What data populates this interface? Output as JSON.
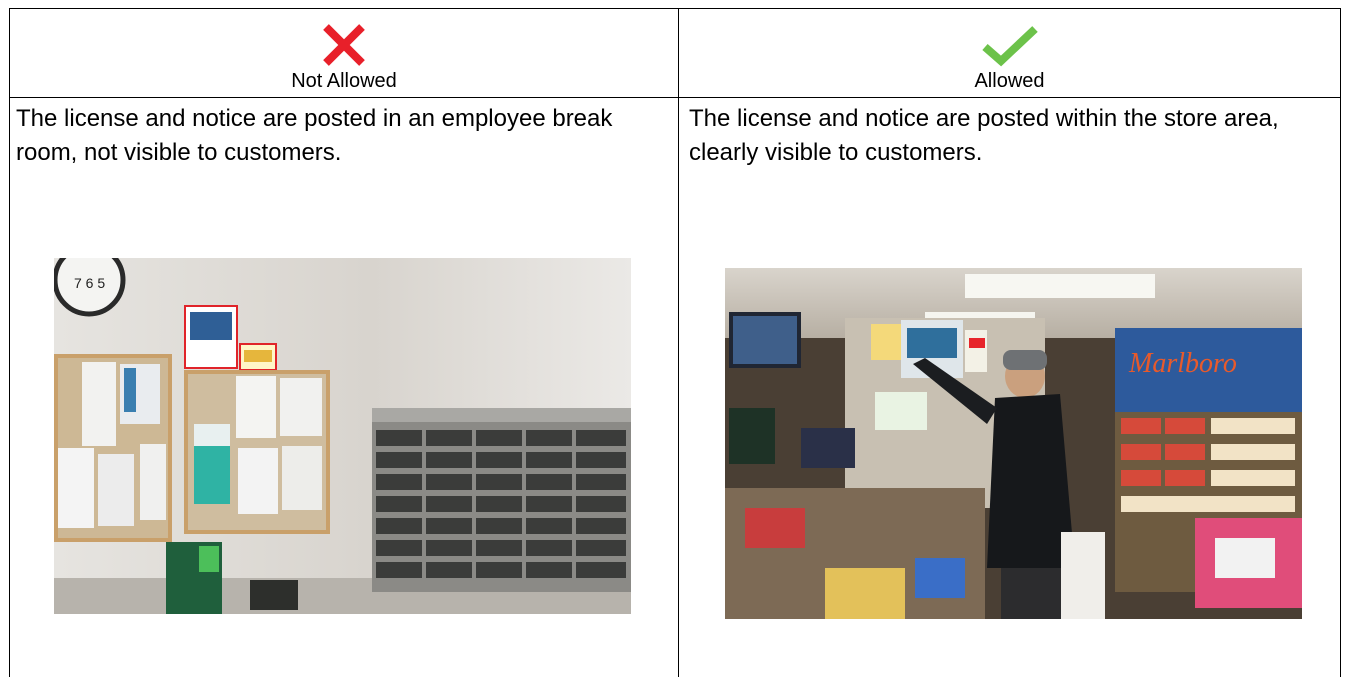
{
  "columns": [
    {
      "status": "Not Allowed",
      "icon": "x-mark-icon",
      "icon_color": "#e8202a",
      "description": "The license and notice are posted in an employee break room, not visible to customers.",
      "photo": "employee-break-room-photo"
    },
    {
      "status": "Allowed",
      "icon": "check-mark-icon",
      "icon_color": "#6cc24a",
      "description": "The license and notice are posted within the store area, clearly visible to customers.",
      "photo": "store-counter-photo"
    }
  ],
  "colors": {
    "highlight_box": "#e0242a"
  }
}
